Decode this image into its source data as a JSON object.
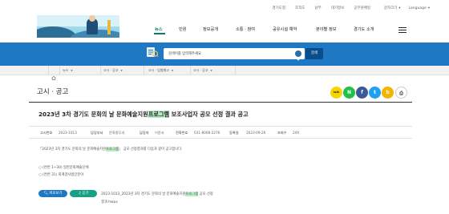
{
  "util": {
    "links": [
      "경기도청",
      "조직도",
      "남부",
      "대기정보",
      "공무원메일"
    ],
    "font_size": "글자크기",
    "language": "Language"
  },
  "gnb": {
    "items": [
      "뉴스",
      "민원",
      "정보공개",
      "소통 · 참여",
      "공유시설 예약",
      "분야별 정보",
      "경기도 소개"
    ],
    "active_index": 0
  },
  "search": {
    "placeholder": "검색어를 입력해주세요",
    "button": "검색"
  },
  "breadcrumb": [
    "뉴스",
    "고시 · 공고",
    "고시 · 입법예고",
    "고시 · 공고"
  ],
  "page": {
    "title": "고시 · 공고"
  },
  "sns": [
    {
      "name": "kakao",
      "label": "talk",
      "color": "#f7d600"
    },
    {
      "name": "naver",
      "label": "N",
      "color": "#20c04a"
    },
    {
      "name": "facebook",
      "label": "f",
      "color": "#3b5998"
    },
    {
      "name": "twitter",
      "label": "t",
      "color": "#1da1f2"
    },
    {
      "name": "band",
      "label": "b",
      "color": "#f4b400"
    },
    {
      "name": "print",
      "label": "⎙",
      "color": "#ffffff"
    }
  ],
  "article": {
    "title_pre": "2023년 3차 경기도 문화의 날 문화예술지원",
    "title_hl": "프로그램",
    "title_post": " 보조사업자 공모 선정 결과 공고",
    "meta": [
      {
        "key": "고시번호",
        "value": "2023-1013"
      },
      {
        "key": "담당부서",
        "value": "문화종무과"
      },
      {
        "key": "담당자",
        "value": "이윤서"
      },
      {
        "key": "전화번호",
        "value": "031-8008-2276"
      },
      {
        "key": "등록일",
        "value": "2023-09-26"
      },
      {
        "key": "조회수",
        "value": "249"
      }
    ],
    "body_line1_pre": "「2023년 3차 경기도 문화의 날 문화예술지원",
    "body_line1_hl": "프로그램",
    "body_line1_post": "」 공모 선정결과를 다음과 같이 공고합니다.",
    "body_items": [
      "○ (연번 1~30) 일반문화예술단체",
      "○ (연번 31) 회계검사법인분야"
    ],
    "view_button": "바로보기",
    "download_button": "듣기",
    "attachment_pre": "2023-1013_2023년 3차 경기도 문화의 날 문화예술지원",
    "attachment_hl": "프로그램",
    "attachment_post": " 공모 선정",
    "attachment_line2": "결과.hwpx"
  },
  "colors": {
    "accent": "#1f78c4",
    "highlight": "#b8ecc4",
    "active_menu": "#0a7a6a"
  }
}
